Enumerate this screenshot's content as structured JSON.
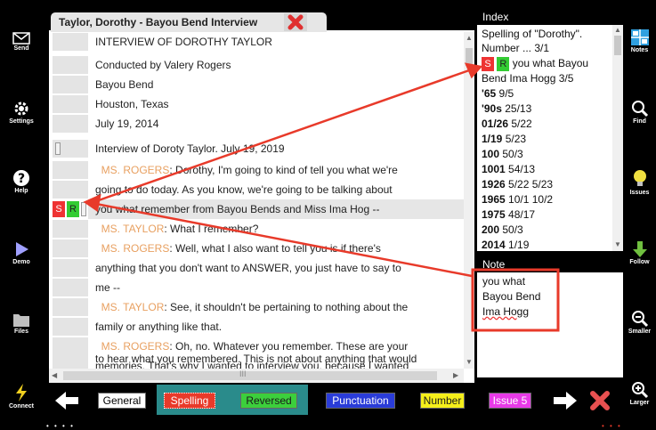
{
  "sidebar": {
    "send": "Send",
    "settings": "Settings",
    "help": "Help",
    "demo": "Demo",
    "files": "Files",
    "connect": "Connect"
  },
  "right_sidebar": {
    "notes": "Notes",
    "find": "Find",
    "issues": "Issues",
    "follow": "Follow",
    "smaller": "Smaller",
    "larger": "Larger"
  },
  "tab": {
    "title": "Taylor, Dorothy - Bayou Bend Interview"
  },
  "transcript": {
    "lines": [
      {
        "text": "INTERVIEW OF DOROTHY TAYLOR"
      },
      {
        "text": "Conducted by Valery Rogers"
      },
      {
        "text": "Bayou Bend"
      },
      {
        "text": "Houston, Texas"
      },
      {
        "text": "July 19, 2014"
      },
      {
        "text": ""
      },
      {
        "text": "Interview of Doroty Taylor.  July 19, 2019"
      },
      {
        "speaker": "MS. ROGERS",
        "text": ":  Dorothy, I'm going to kind of tell you what we're"
      },
      {
        "text": "going to do today.  As you know, we're going to be talking about"
      },
      {
        "text": "you what remember from Bayou Bends and Miss Ima Hog --",
        "tag_s": "S",
        "tag_r": "R"
      },
      {
        "speaker": "MS. TAYLOR",
        "text": ":  What I remember?"
      },
      {
        "speaker": "MS. ROGERS",
        "text": ":  Well, what I also want to tell you is if there's"
      },
      {
        "text": "anything that you don't want to ANSWER, you just have to say to"
      },
      {
        "text": "me --"
      },
      {
        "speaker": "MS. TAYLOR",
        "text": ":  See, it shouldn't be pertaining to nothing about the"
      },
      {
        "text": "family or anything like that."
      },
      {
        "speaker": "MS. ROGERS",
        "text": ":  Oh, no.  Whatever you remember.  These are your"
      },
      {
        "text": "memories.  That's why I wanted to interview you, because I wanted"
      },
      {
        "text": "to hear what you remembered.  This is not about anything that would"
      }
    ],
    "hscroll_label": "III"
  },
  "index": {
    "header": "Index",
    "line1": "Spelling of \"Dorothy\".",
    "line2": "Number ... 3/1",
    "tag_s": "S",
    "tag_r": "R",
    "tagged_text": "you what Bayou",
    "line4": "Bend Ima Hogg 3/5",
    "entries": [
      {
        "term": "'65",
        "refs": "9/5"
      },
      {
        "term": "'90s",
        "refs": "25/13"
      },
      {
        "term": "01/26",
        "refs": "5/22"
      },
      {
        "term": "1/19",
        "refs": "5/23"
      },
      {
        "term": "100",
        "refs": "50/3"
      },
      {
        "term": "1001",
        "refs": "54/13"
      },
      {
        "term": "1926",
        "refs": "5/22 5/23"
      },
      {
        "term": "1965",
        "refs": "10/1 10/2"
      },
      {
        "term": "1975",
        "refs": "48/17"
      },
      {
        "term": "200",
        "refs": "50/3"
      },
      {
        "term": "2014",
        "refs": "1/19"
      }
    ]
  },
  "note": {
    "header": "Note",
    "line1": "you what",
    "line2": "Bayou Bend",
    "line3": "Ima Hogg"
  },
  "toolbar": {
    "categories": [
      {
        "label": "General",
        "bg": "#ffffff",
        "fg": "#000000"
      },
      {
        "label": "Spelling",
        "bg": "#e83a2a",
        "fg": "#ffffff"
      },
      {
        "label": "Reversed",
        "bg": "#3ccf3c",
        "fg": "#1a1a1a"
      },
      {
        "label": "Punctuation",
        "bg": "#2a3cd8",
        "fg": "#ffffff"
      },
      {
        "label": "Number",
        "bg": "#f5ef1a",
        "fg": "#1a1a1a"
      },
      {
        "label": "Issue 5",
        "bg": "#e83ae8",
        "fg": "#ffffff"
      }
    ]
  },
  "colors": {
    "highlight": "#2a8b8b",
    "arrow": "#e83a2a",
    "speaker": "#e8a060",
    "issues_icon": "#f0e040",
    "follow_icon": "#70c040"
  }
}
